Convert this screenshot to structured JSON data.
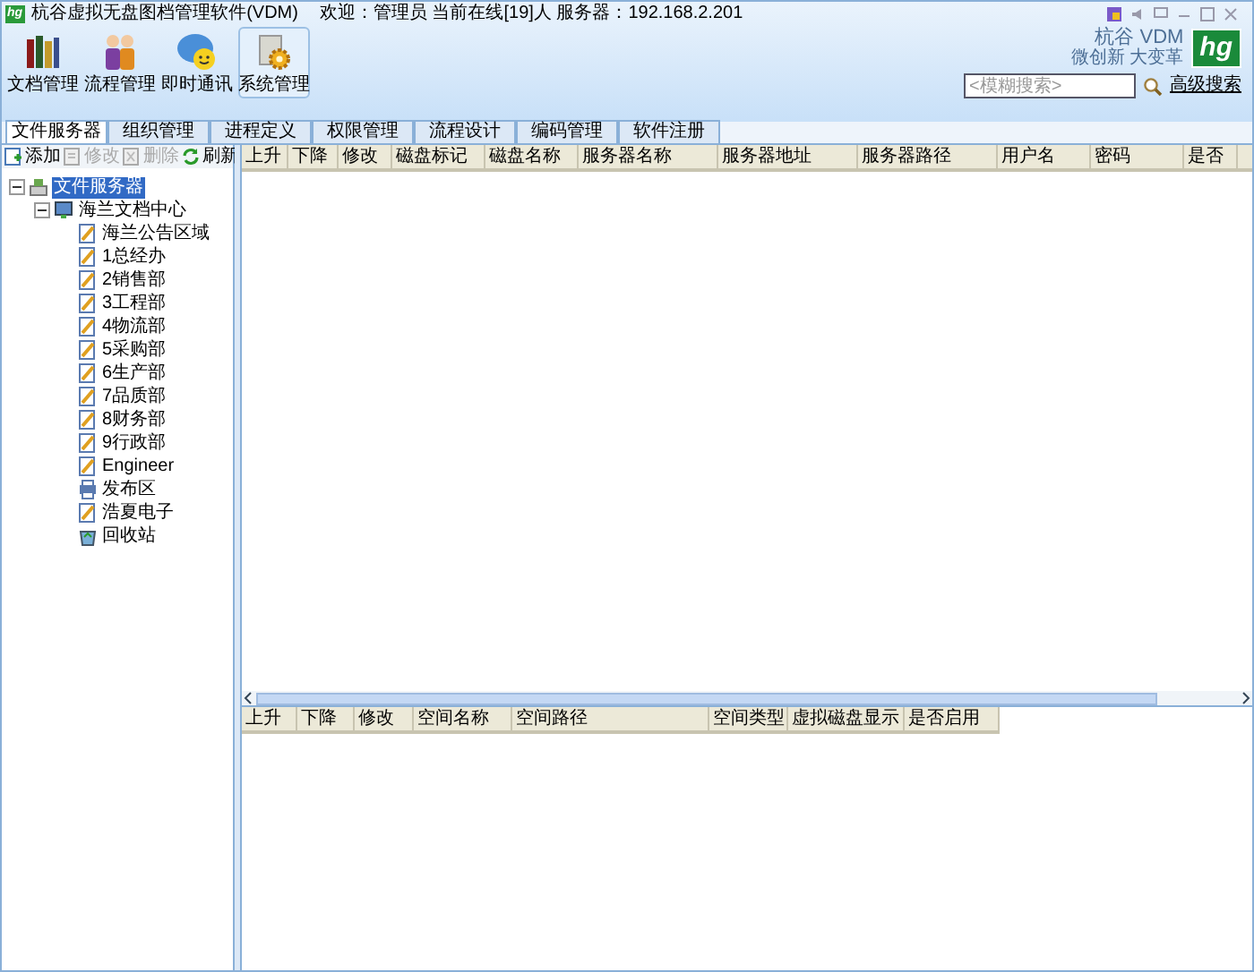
{
  "window": {
    "logo": "hg",
    "title": "杭谷虚拟无盘图档管理软件(VDM)",
    "status": "欢迎：管理员 当前在线[19]人 服务器：192.168.2.201"
  },
  "brand": {
    "name": "杭谷 VDM",
    "slogan": "微创新 大变革",
    "logo": "hg"
  },
  "toolbar": [
    {
      "label": "文档管理",
      "kind": "books",
      "selected": false
    },
    {
      "label": "流程管理",
      "kind": "people",
      "selected": false
    },
    {
      "label": "即时通讯",
      "kind": "chat",
      "selected": false
    },
    {
      "label": "系统管理",
      "kind": "gear",
      "selected": true
    }
  ],
  "search": {
    "placeholder": "<模糊搜索>",
    "advanced": "高级搜索"
  },
  "tabs": [
    {
      "label": "文件服务器",
      "selected": true
    },
    {
      "label": "组织管理",
      "selected": false
    },
    {
      "label": "进程定义",
      "selected": false
    },
    {
      "label": "权限管理",
      "selected": false
    },
    {
      "label": "流程设计",
      "selected": false
    },
    {
      "label": "编码管理",
      "selected": false
    },
    {
      "label": "软件注册",
      "selected": false
    }
  ],
  "actions": [
    {
      "label": "添加",
      "kind": "add",
      "disabled": false
    },
    {
      "label": "修改",
      "kind": "edit",
      "disabled": true
    },
    {
      "label": "删除",
      "kind": "delete",
      "disabled": true
    },
    {
      "label": "刷新",
      "kind": "refresh",
      "disabled": false
    }
  ],
  "tree": [
    {
      "label": "文件服务器",
      "kind": "server",
      "selected": true,
      "expanded": true,
      "children": [
        {
          "label": "海兰文档中心",
          "kind": "center",
          "selected": false,
          "expanded": true,
          "children": [
            {
              "label": "海兰公告区域",
              "kind": "doc",
              "selected": false
            },
            {
              "label": "1总经办",
              "kind": "doc",
              "selected": false
            },
            {
              "label": "2销售部",
              "kind": "doc",
              "selected": false
            },
            {
              "label": "3工程部",
              "kind": "doc",
              "selected": false
            },
            {
              "label": "4物流部",
              "kind": "doc",
              "selected": false
            },
            {
              "label": "5采购部",
              "kind": "doc",
              "selected": false
            },
            {
              "label": "6生产部",
              "kind": "doc",
              "selected": false
            },
            {
              "label": "7品质部",
              "kind": "doc",
              "selected": false
            },
            {
              "label": "8财务部",
              "kind": "doc",
              "selected": false
            },
            {
              "label": "9行政部",
              "kind": "doc",
              "selected": false
            },
            {
              "label": "Engineer",
              "kind": "doc",
              "selected": false
            },
            {
              "label": "发布区",
              "kind": "publish",
              "selected": false
            },
            {
              "label": "浩夏电子",
              "kind": "doc",
              "selected": false
            },
            {
              "label": "回收站",
              "kind": "recycle",
              "selected": false
            }
          ]
        }
      ]
    }
  ],
  "server_table": {
    "columns": [
      "上升",
      "下降",
      "修改",
      "磁盘标记",
      "磁盘名称",
      "服务器名称",
      "服务器地址",
      "服务器路径",
      "用户名",
      "密码",
      "是否"
    ]
  },
  "space_table": {
    "columns": [
      "上升",
      "下降",
      "修改",
      "空间名称",
      "空间路径",
      "空间类型",
      "虚拟磁盘显示",
      "是否启用"
    ]
  }
}
